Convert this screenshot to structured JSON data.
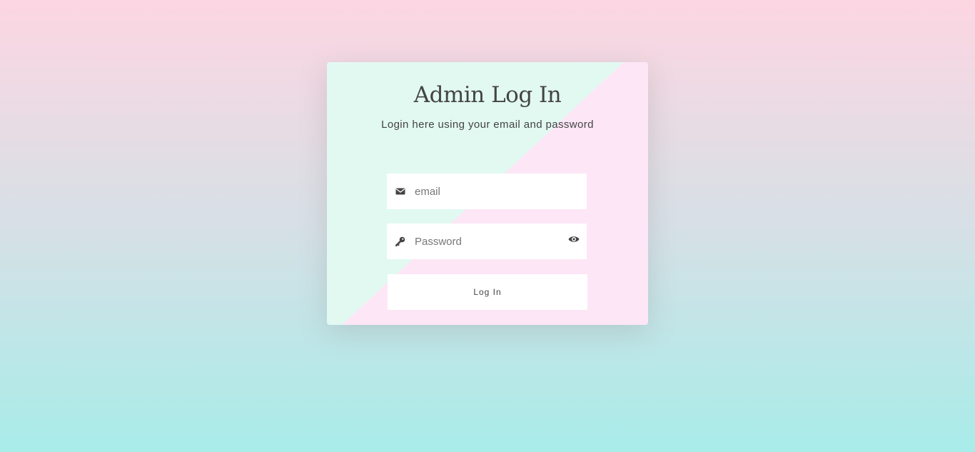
{
  "login": {
    "title": "Admin Log In",
    "subtitle": "Login here using your email and password",
    "email_placeholder": "email",
    "email_value": "",
    "password_placeholder": "Password",
    "password_value": "",
    "submit_label": "Log In"
  },
  "icons": {
    "email": "envelope-icon",
    "password": "key-icon",
    "toggle": "eye-icon"
  },
  "colors": {
    "card_mint": "#e2f9f2",
    "card_pink": "#fde6f6",
    "text": "#444444"
  }
}
